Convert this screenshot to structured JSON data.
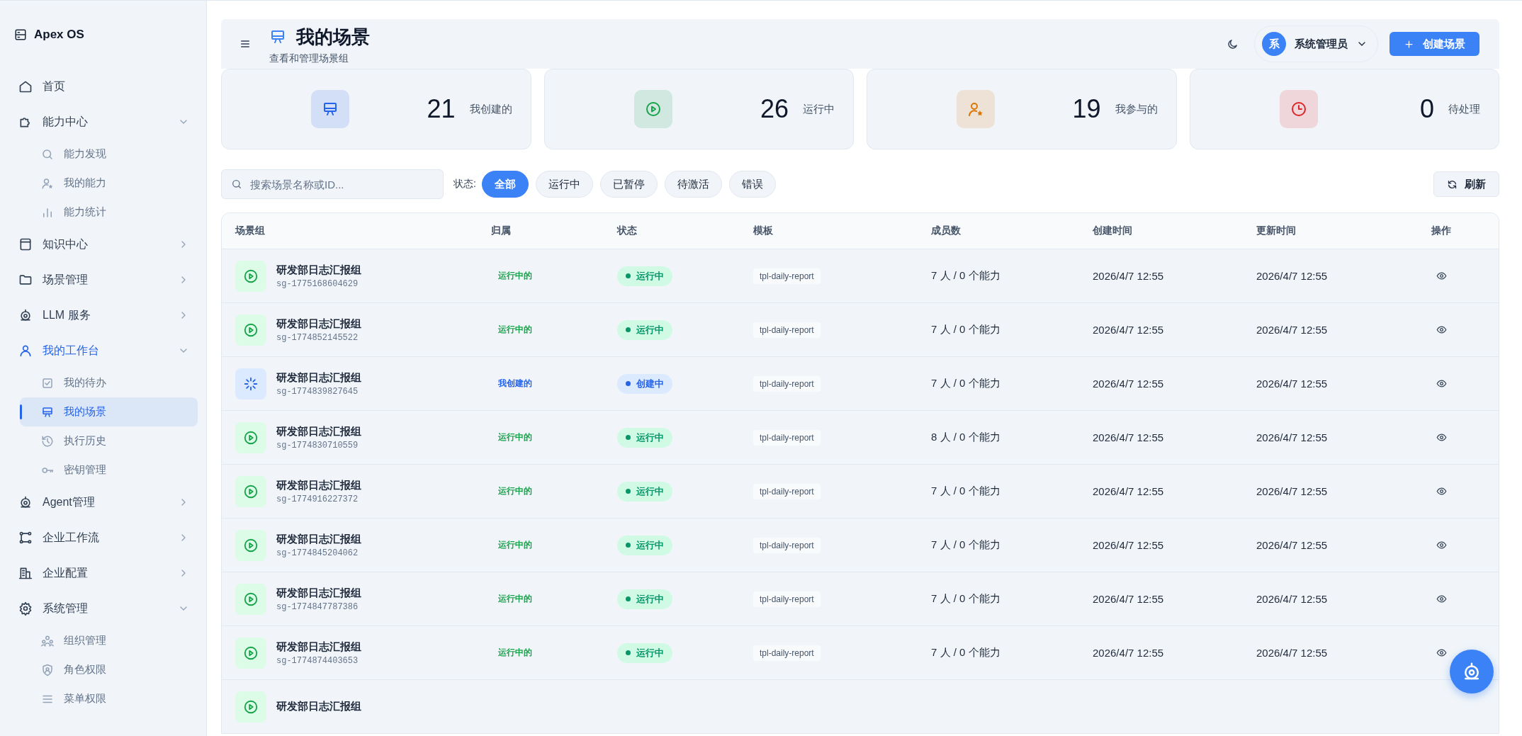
{
  "sidebar": {
    "brand": "Apex OS",
    "items": [
      {
        "label": "首页",
        "selected": false
      },
      {
        "label": "能力中心",
        "selected": false,
        "expanded": true,
        "children": [
          {
            "label": "能力发现",
            "selected": false
          },
          {
            "label": "我的能力",
            "selected": false
          },
          {
            "label": "能力统计",
            "selected": false
          }
        ]
      },
      {
        "label": "知识中心",
        "selected": false,
        "expanded": false
      },
      {
        "label": "场景管理",
        "selected": false,
        "expanded": false
      },
      {
        "label": "LLM 服务",
        "selected": false,
        "expanded": false
      },
      {
        "label": "我的工作台",
        "selected": true,
        "expanded": true,
        "children": [
          {
            "label": "我的待办",
            "selected": false
          },
          {
            "label": "我的场景",
            "selected": true
          },
          {
            "label": "执行历史",
            "selected": false
          },
          {
            "label": "密钥管理",
            "selected": false
          }
        ]
      },
      {
        "label": "Agent管理",
        "selected": false,
        "expanded": false
      },
      {
        "label": "企业工作流",
        "selected": false,
        "expanded": false
      },
      {
        "label": "企业配置",
        "selected": false,
        "expanded": false
      },
      {
        "label": "系统管理",
        "selected": false,
        "expanded": true,
        "children": [
          {
            "label": "组织管理",
            "selected": false
          },
          {
            "label": "角色权限",
            "selected": false
          },
          {
            "label": "菜单权限",
            "selected": false
          }
        ]
      }
    ]
  },
  "header": {
    "title": "我的场景",
    "subtitle": "查看和管理场景组",
    "user": {
      "avatar": "系",
      "name": "系统管理员"
    },
    "create_button": "创建场景"
  },
  "stats": [
    {
      "value": "21",
      "label": "我创建的",
      "color": "#2563eb"
    },
    {
      "value": "26",
      "label": "运行中",
      "color": "#16a34a"
    },
    {
      "value": "19",
      "label": "我参与的",
      "color": "#d97706"
    },
    {
      "value": "0",
      "label": "待处理",
      "color": "#dc2626"
    }
  ],
  "filters": {
    "search": {
      "placeholder": "搜索场景名称或ID..."
    },
    "status_label": "状态:",
    "chips": [
      {
        "label": "全部",
        "selected": true
      },
      {
        "label": "运行中",
        "selected": false
      },
      {
        "label": "已暂停",
        "selected": false
      },
      {
        "label": "待激活",
        "selected": false
      },
      {
        "label": "错误",
        "selected": false
      }
    ],
    "refresh_button": "刷新"
  },
  "table": {
    "columns": [
      "场景组",
      "归属",
      "状态",
      "模板",
      "成员数",
      "创建时间",
      "更新时间",
      "操作"
    ],
    "rows": [
      {
        "kind": "running",
        "name": "研发部日志汇报组",
        "id": "sg-1775168604629",
        "owner": "运行中的",
        "status": "运行中",
        "template": "tpl-daily-report",
        "members": "7 人 / 0 个能力",
        "created": "2026/4/7 12:55",
        "updated": "2026/4/7 12:55"
      },
      {
        "kind": "running",
        "name": "研发部日志汇报组",
        "id": "sg-1774852145522",
        "owner": "运行中的",
        "status": "运行中",
        "template": "tpl-daily-report",
        "members": "7 人 / 0 个能力",
        "created": "2026/4/7 12:55",
        "updated": "2026/4/7 12:55"
      },
      {
        "kind": "creating",
        "name": "研发部日志汇报组",
        "id": "sg-1774839827645",
        "owner": "我创建的",
        "status": "创建中",
        "template": "tpl-daily-report",
        "members": "7 人 / 0 个能力",
        "created": "2026/4/7 12:55",
        "updated": "2026/4/7 12:55"
      },
      {
        "kind": "running",
        "name": "研发部日志汇报组",
        "id": "sg-1774830710559",
        "owner": "运行中的",
        "status": "运行中",
        "template": "tpl-daily-report",
        "members": "8 人 / 0 个能力",
        "created": "2026/4/7 12:55",
        "updated": "2026/4/7 12:55"
      },
      {
        "kind": "running",
        "name": "研发部日志汇报组",
        "id": "sg-1774916227372",
        "owner": "运行中的",
        "status": "运行中",
        "template": "tpl-daily-report",
        "members": "7 人 / 0 个能力",
        "created": "2026/4/7 12:55",
        "updated": "2026/4/7 12:55"
      },
      {
        "kind": "running",
        "name": "研发部日志汇报组",
        "id": "sg-1774845204062",
        "owner": "运行中的",
        "status": "运行中",
        "template": "tpl-daily-report",
        "members": "7 人 / 0 个能力",
        "created": "2026/4/7 12:55",
        "updated": "2026/4/7 12:55"
      },
      {
        "kind": "running",
        "name": "研发部日志汇报组",
        "id": "sg-1774847787386",
        "owner": "运行中的",
        "status": "运行中",
        "template": "tpl-daily-report",
        "members": "7 人 / 0 个能力",
        "created": "2026/4/7 12:55",
        "updated": "2026/4/7 12:55"
      },
      {
        "kind": "running",
        "name": "研发部日志汇报组",
        "id": "sg-1774874403653",
        "owner": "运行中的",
        "status": "运行中",
        "template": "tpl-daily-report",
        "members": "7 人 / 0 个能力",
        "created": "2026/4/7 12:55",
        "updated": "2026/4/7 12:55"
      },
      {
        "kind": "running",
        "name": "研发部日志汇报组"
      }
    ]
  }
}
